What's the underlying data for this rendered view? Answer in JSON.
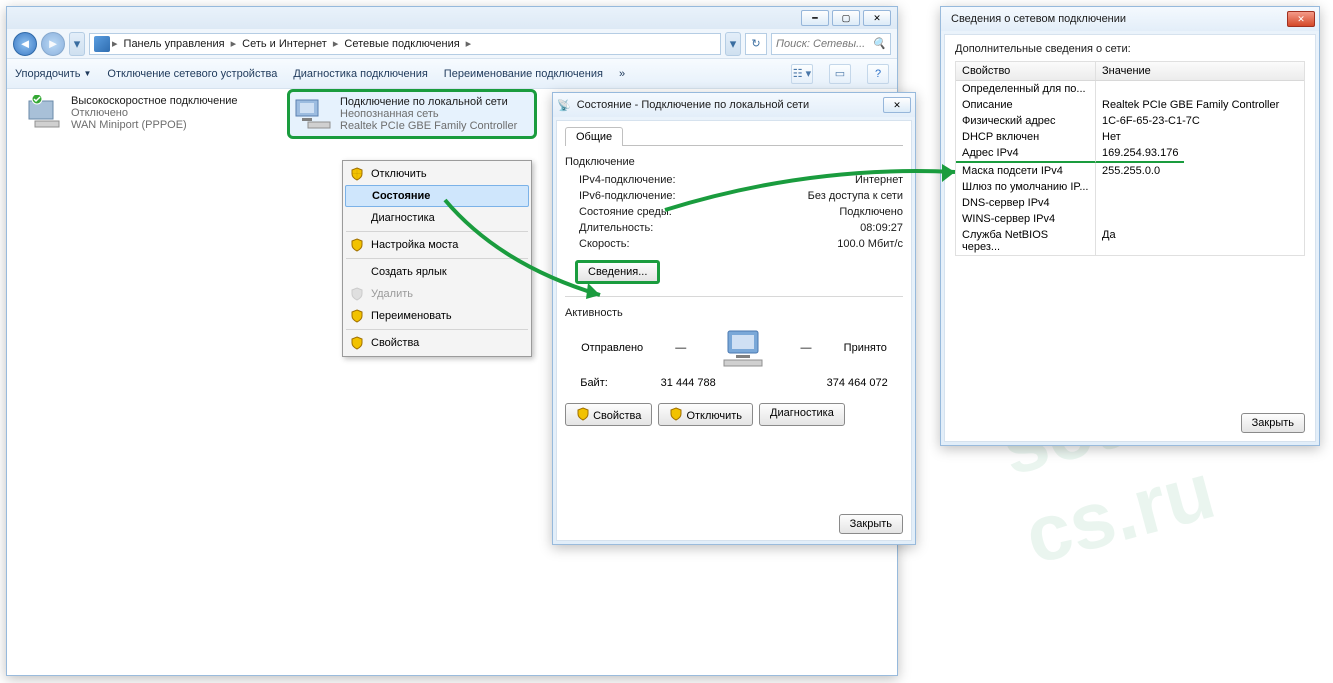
{
  "explorer": {
    "breadcrumb": [
      "Панель управления",
      "Сеть и Интернет",
      "Сетевые подключения"
    ],
    "search_placeholder": "Поиск: Сетевы...",
    "toolbar": {
      "organize": "Упорядочить",
      "disable_device": "Отключение сетевого устройства",
      "diagnose": "Диагностика подключения",
      "rename": "Переименование подключения"
    },
    "connections": {
      "broadband": {
        "title": "Высокоскоростное подключение",
        "status": "Отключено",
        "device": "WAN Miniport (PPPOE)"
      },
      "lan": {
        "title": "Подключение по локальной сети",
        "status": "Неопознанная сеть",
        "device": "Realtek PCIe GBE Family Controller"
      }
    }
  },
  "context_menu": {
    "disable": "Отключить",
    "status": "Состояние",
    "diagnose": "Диагностика",
    "bridge": "Настройка моста",
    "shortcut": "Создать ярлык",
    "delete": "Удалить",
    "rename": "Переименовать",
    "properties": "Свойства"
  },
  "status_dialog": {
    "title": "Состояние - Подключение по локальной сети",
    "tab_general": "Общие",
    "group_conn": "Подключение",
    "ipv4_conn_k": "IPv4-подключение:",
    "ipv4_conn_v": "Интернет",
    "ipv6_conn_k": "IPv6-подключение:",
    "ipv6_conn_v": "Без доступа к сети",
    "media_k": "Состояние среды:",
    "media_v": "Подключено",
    "duration_k": "Длительность:",
    "duration_v": "08:09:27",
    "speed_k": "Скорость:",
    "speed_v": "100.0 Мбит/с",
    "details_btn": "Сведения...",
    "group_activity": "Активность",
    "sent": "Отправлено",
    "received": "Принято",
    "bytes_k": "Байт:",
    "bytes_sent": "31 444 788",
    "bytes_recv": "374 464 072",
    "props_btn": "Свойства",
    "disable_btn": "Отключить",
    "diag_btn": "Диагностика",
    "close_btn": "Закрыть"
  },
  "details_dialog": {
    "title": "Сведения о сетевом подключении",
    "fieldset": "Дополнительные сведения о сети:",
    "col_prop": "Свойство",
    "col_val": "Значение",
    "rows": [
      {
        "k": "Определенный для по...",
        "v": ""
      },
      {
        "k": "Описание",
        "v": "Realtek PCIe GBE Family Controller"
      },
      {
        "k": "Физический адрес",
        "v": "1C-6F-65-23-C1-7C"
      },
      {
        "k": "DHCP включен",
        "v": "Нет"
      },
      {
        "k": "Адрес IPv4",
        "v": "169.254.93.176",
        "hl": true
      },
      {
        "k": "Маска подсети IPv4",
        "v": "255.255.0.0"
      },
      {
        "k": "Шлюз по умолчанию IP...",
        "v": ""
      },
      {
        "k": "DNS-сервер IPv4",
        "v": ""
      },
      {
        "k": "WINS-сервер IPv4",
        "v": ""
      },
      {
        "k": "Служба NetBIOS через...",
        "v": "Да"
      }
    ],
    "close_btn": "Закрыть"
  }
}
